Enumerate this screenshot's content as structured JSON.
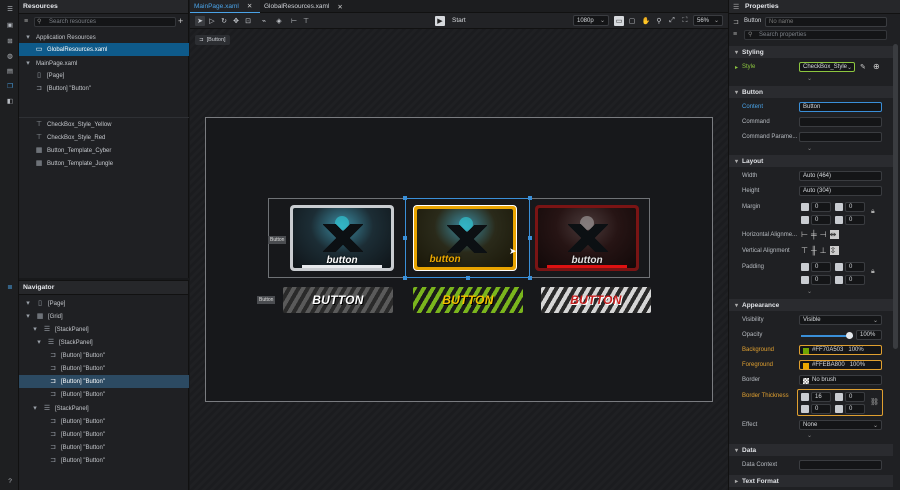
{
  "resources": {
    "title": "Resources",
    "search_placeholder": "Search resources",
    "items": [
      {
        "label": "Application Resources"
      },
      {
        "label": "GlobalResources.xaml"
      },
      {
        "label": "MainPage.xaml"
      },
      {
        "label": "[Page]"
      },
      {
        "label": "[Button] \"Button\""
      },
      {
        "label": "CheckBox_Style_Yellow"
      },
      {
        "label": "CheckBox_Style_Red"
      },
      {
        "label": "Button_Template_Cyber"
      },
      {
        "label": "Button_Template_Jungle"
      }
    ]
  },
  "navigator": {
    "title": "Navigator",
    "items": [
      {
        "label": "[Page]"
      },
      {
        "label": "[Grid]"
      },
      {
        "label": "[StackPanel]"
      },
      {
        "label": "[StackPanel]"
      },
      {
        "label": "[Button] \"Button\""
      },
      {
        "label": "[Button] \"Button\""
      },
      {
        "label": "[Button] \"Button\""
      },
      {
        "label": "[Button] \"Button\""
      },
      {
        "label": "[StackPanel]"
      },
      {
        "label": "[Button] \"Button\""
      },
      {
        "label": "[Button] \"Button\""
      },
      {
        "label": "[Button] \"Button\""
      },
      {
        "label": "[Button] \"Button\""
      }
    ]
  },
  "tabs": [
    {
      "label": "MainPage.xaml"
    },
    {
      "label": "GlobalResources.xaml"
    }
  ],
  "toolbar": {
    "start_label": "Start",
    "resolution": "1080p",
    "zoom": "56%"
  },
  "canvas": {
    "breadcrumb": "[Button]",
    "stack_label_1": "Button",
    "stack_label_2": "Button",
    "card_buttons": [
      "button",
      "button",
      "button"
    ],
    "zebra_buttons": [
      "BUTTON",
      "BUTTON",
      "BUTTON"
    ]
  },
  "properties": {
    "title": "Properties",
    "element_type": "Button",
    "name_placeholder": "No name",
    "search_placeholder": "Search properties",
    "sections": {
      "styling": "Styling",
      "button": "Button",
      "layout": "Layout",
      "appearance": "Appearance",
      "data": "Data",
      "text_format": "Text Format"
    },
    "style": {
      "label": "Style",
      "value": "CheckBox_Style"
    },
    "content": {
      "label": "Content",
      "value": "Button"
    },
    "command": {
      "label": "Command",
      "value": ""
    },
    "command_param": {
      "label": "Command Parame...",
      "value": ""
    },
    "width": {
      "label": "Width",
      "value": "Auto (464)"
    },
    "height": {
      "label": "Height",
      "value": "Auto (304)"
    },
    "margin": {
      "label": "Margin",
      "values": [
        "0",
        "0",
        "0",
        "0"
      ]
    },
    "halign": {
      "label": "Horizontal Alignme..."
    },
    "valign": {
      "label": "Vertical Alignment"
    },
    "padding": {
      "label": "Padding",
      "values": [
        "0",
        "0",
        "0",
        "0"
      ]
    },
    "visibility": {
      "label": "Visibility",
      "value": "Visible"
    },
    "opacity": {
      "label": "Opacity",
      "value": "100%",
      "level": 1.0
    },
    "background": {
      "label": "Background",
      "value": "#FF70A503",
      "pct": "100%",
      "color": "#70A503"
    },
    "foreground": {
      "label": "Foreground",
      "value": "#FFEBA800",
      "pct": "100%",
      "color": "#EBA800"
    },
    "border": {
      "label": "Border",
      "value": "No brush"
    },
    "border_thickness": {
      "label": "Border Thickness",
      "values": [
        "16",
        "0",
        "0",
        "0"
      ]
    },
    "effect": {
      "label": "Effect",
      "value": "None"
    },
    "data_context": {
      "label": "Data Context",
      "value": ""
    }
  },
  "colors": {
    "accent": "#0E5A8A",
    "selection": "#3A8FD8",
    "highlight_orange": "#E0A030",
    "style_green": "#8CC63F"
  }
}
